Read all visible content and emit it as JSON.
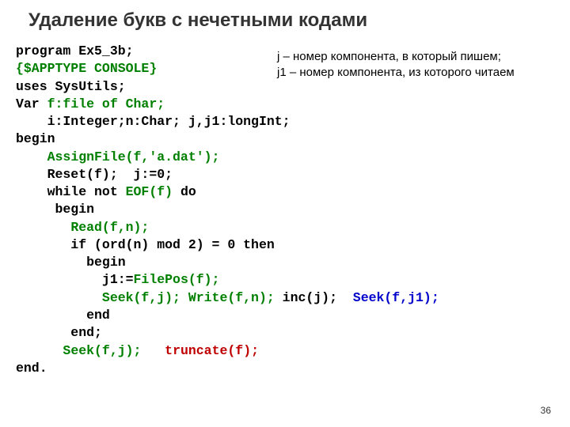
{
  "title": "Удаление букв с нечетными кодами",
  "notes": {
    "line1": "j – номер компонента, в который пишем;",
    "line2": "j1 – номер компонента, из которого читаем"
  },
  "code": {
    "l1a": "program Ex5_3b;",
    "l2a": "{$APPTYPE CONSOLE}",
    "l3a": "uses SysUtils;",
    "l4a": "Var ",
    "l4b": "f:file of Char;",
    "l5a": "    i:Integer;n:Char; j,j1:longInt;",
    "l6a": "begin",
    "l7a": "    ",
    "l7b": "AssignFile(f,'a.dat');",
    "l8a": "    Reset(f);  j:=0;",
    "l9a": "    while not ",
    "l9b": "EOF(f)",
    "l9c": " do",
    "l10a": "     begin",
    "l11a": "       ",
    "l11b": "Read(f,n);",
    "l12a": "       if (ord(n) mod 2) = 0 then ",
    "l13a": "         begin",
    "l14a": "           j1:=",
    "l14b": "FilePos(f);",
    "l15a": "           ",
    "l15b": "Seek(f,j); Write(f,n);",
    "l15c": " inc(j);  ",
    "l15d": "Seek(f,j1);",
    "l16a": "         end",
    "l17a": "       end;",
    "l18a": "      ",
    "l18b": "Seek(f,j);",
    "l18c": "   ",
    "l18d": "truncate(f);",
    "l19a": "end."
  },
  "page": "36"
}
